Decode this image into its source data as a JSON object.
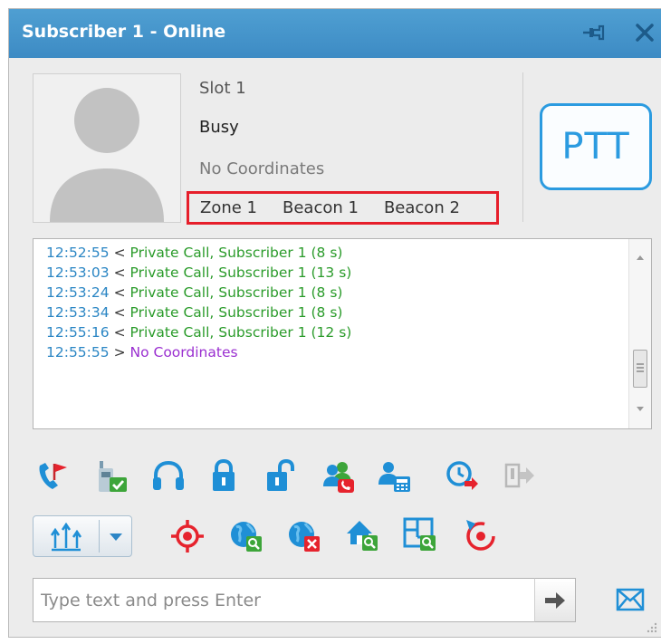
{
  "window": {
    "title": "Subscriber 1 - Online"
  },
  "subscriber": {
    "slot": "Slot 1",
    "status": "Busy",
    "coordinates": "No Coordinates",
    "zone": "Zone 1",
    "beacons": [
      "Beacon 1",
      "Beacon 2"
    ]
  },
  "ptt": {
    "label": "PTT"
  },
  "log": [
    {
      "time": "12:52:55",
      "dir": "<",
      "text": "Private Call, Subscriber 1 (8 s)",
      "color": "green"
    },
    {
      "time": "12:53:03",
      "dir": "<",
      "text": "Private Call, Subscriber 1 (13 s)",
      "color": "green"
    },
    {
      "time": "12:53:24",
      "dir": "<",
      "text": "Private Call, Subscriber 1 (8 s)",
      "color": "green"
    },
    {
      "time": "12:53:34",
      "dir": "<",
      "text": "Private Call, Subscriber 1 (8 s)",
      "color": "green"
    },
    {
      "time": "12:55:16",
      "dir": "<",
      "text": "Private Call, Subscriber 1 (12 s)",
      "color": "green"
    },
    {
      "time": "12:55:55",
      "dir": ">",
      "text": "No Coordinates",
      "color": "purple"
    }
  ],
  "toolbar_row1": [
    "call-alert-icon",
    "radio-check-icon",
    "headset-icon",
    "lock-icon",
    "unlock-icon",
    "group-call-icon",
    "telephone-interconnect-icon",
    "scheduled-task-icon",
    "exit-disabled-icon"
  ],
  "toolbar_row2": [
    "location-request-icon",
    "find-on-map-icon",
    "remove-from-map-icon",
    "home-zone-icon",
    "indoor-map-icon",
    "track-icon"
  ],
  "message": {
    "placeholder": "Type text and press Enter"
  },
  "colors": {
    "title_bar": "#4a98cf",
    "ptt": "#2b9be0",
    "highlight": "#e61e2a",
    "timestamp": "#2b86c4",
    "call_text": "#2a9b2a",
    "gps_text": "#9a2fd0"
  }
}
